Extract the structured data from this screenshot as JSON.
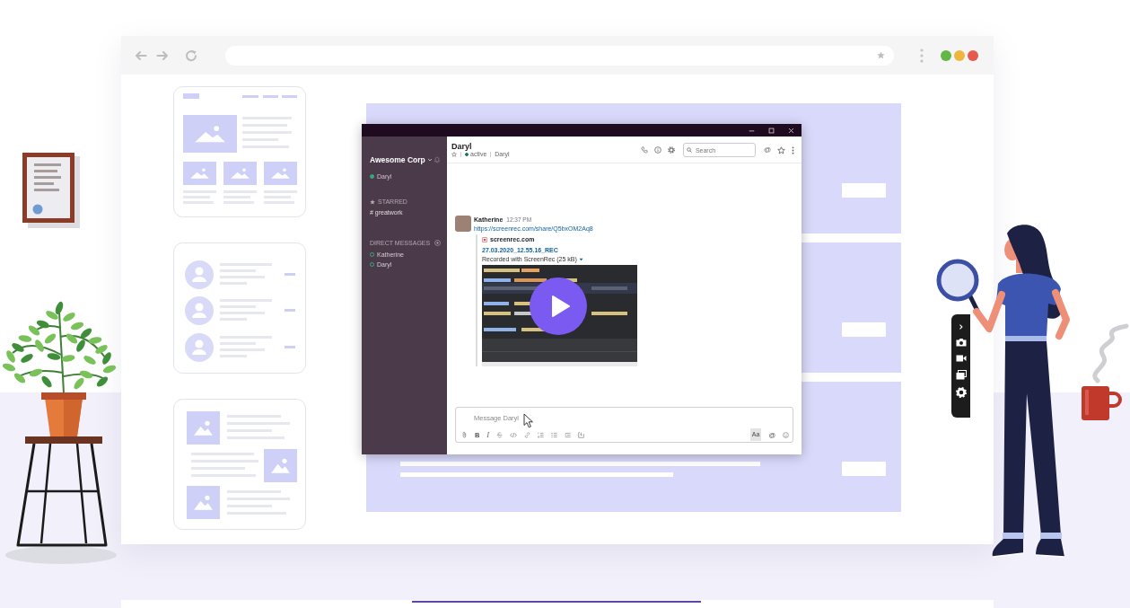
{
  "browser": {
    "window_dots": [
      {
        "color": "#62b746"
      },
      {
        "color": "#f0b53d"
      },
      {
        "color": "#e35a4e"
      }
    ]
  },
  "app": {
    "workspace": "Awesome Corp",
    "user": {
      "name": "Daryl",
      "active": true
    },
    "starred": {
      "heading": "STARRED",
      "channels": [
        "# greatwork"
      ]
    },
    "direct_messages": {
      "heading": "DIRECT MESSAGES",
      "items": [
        {
          "name": "Katherine",
          "active": false
        },
        {
          "name": "Daryl",
          "active": false
        }
      ]
    },
    "conversation": {
      "title": "Daryl",
      "online": true,
      "status": "active",
      "member": "Daryl",
      "search": {
        "placeholder": "Search"
      },
      "mentions": "@"
    },
    "messages": [
      {
        "author": "Katherine",
        "time": "12:37 PM",
        "link": "https://screenrec.com/share/Q5bxOM2Aq8",
        "attachment": {
          "site": "screenrec.com",
          "title": "27.03.2020_12.55.16_REC",
          "description": "Recorded with ScreenRec (25 kB)"
        }
      }
    ],
    "composer": {
      "placeholder": "Message Daryl",
      "bold": "B",
      "italic": "I",
      "format_toggle": {
        "label": "Aa",
        "on": true
      },
      "mention": "@"
    }
  }
}
